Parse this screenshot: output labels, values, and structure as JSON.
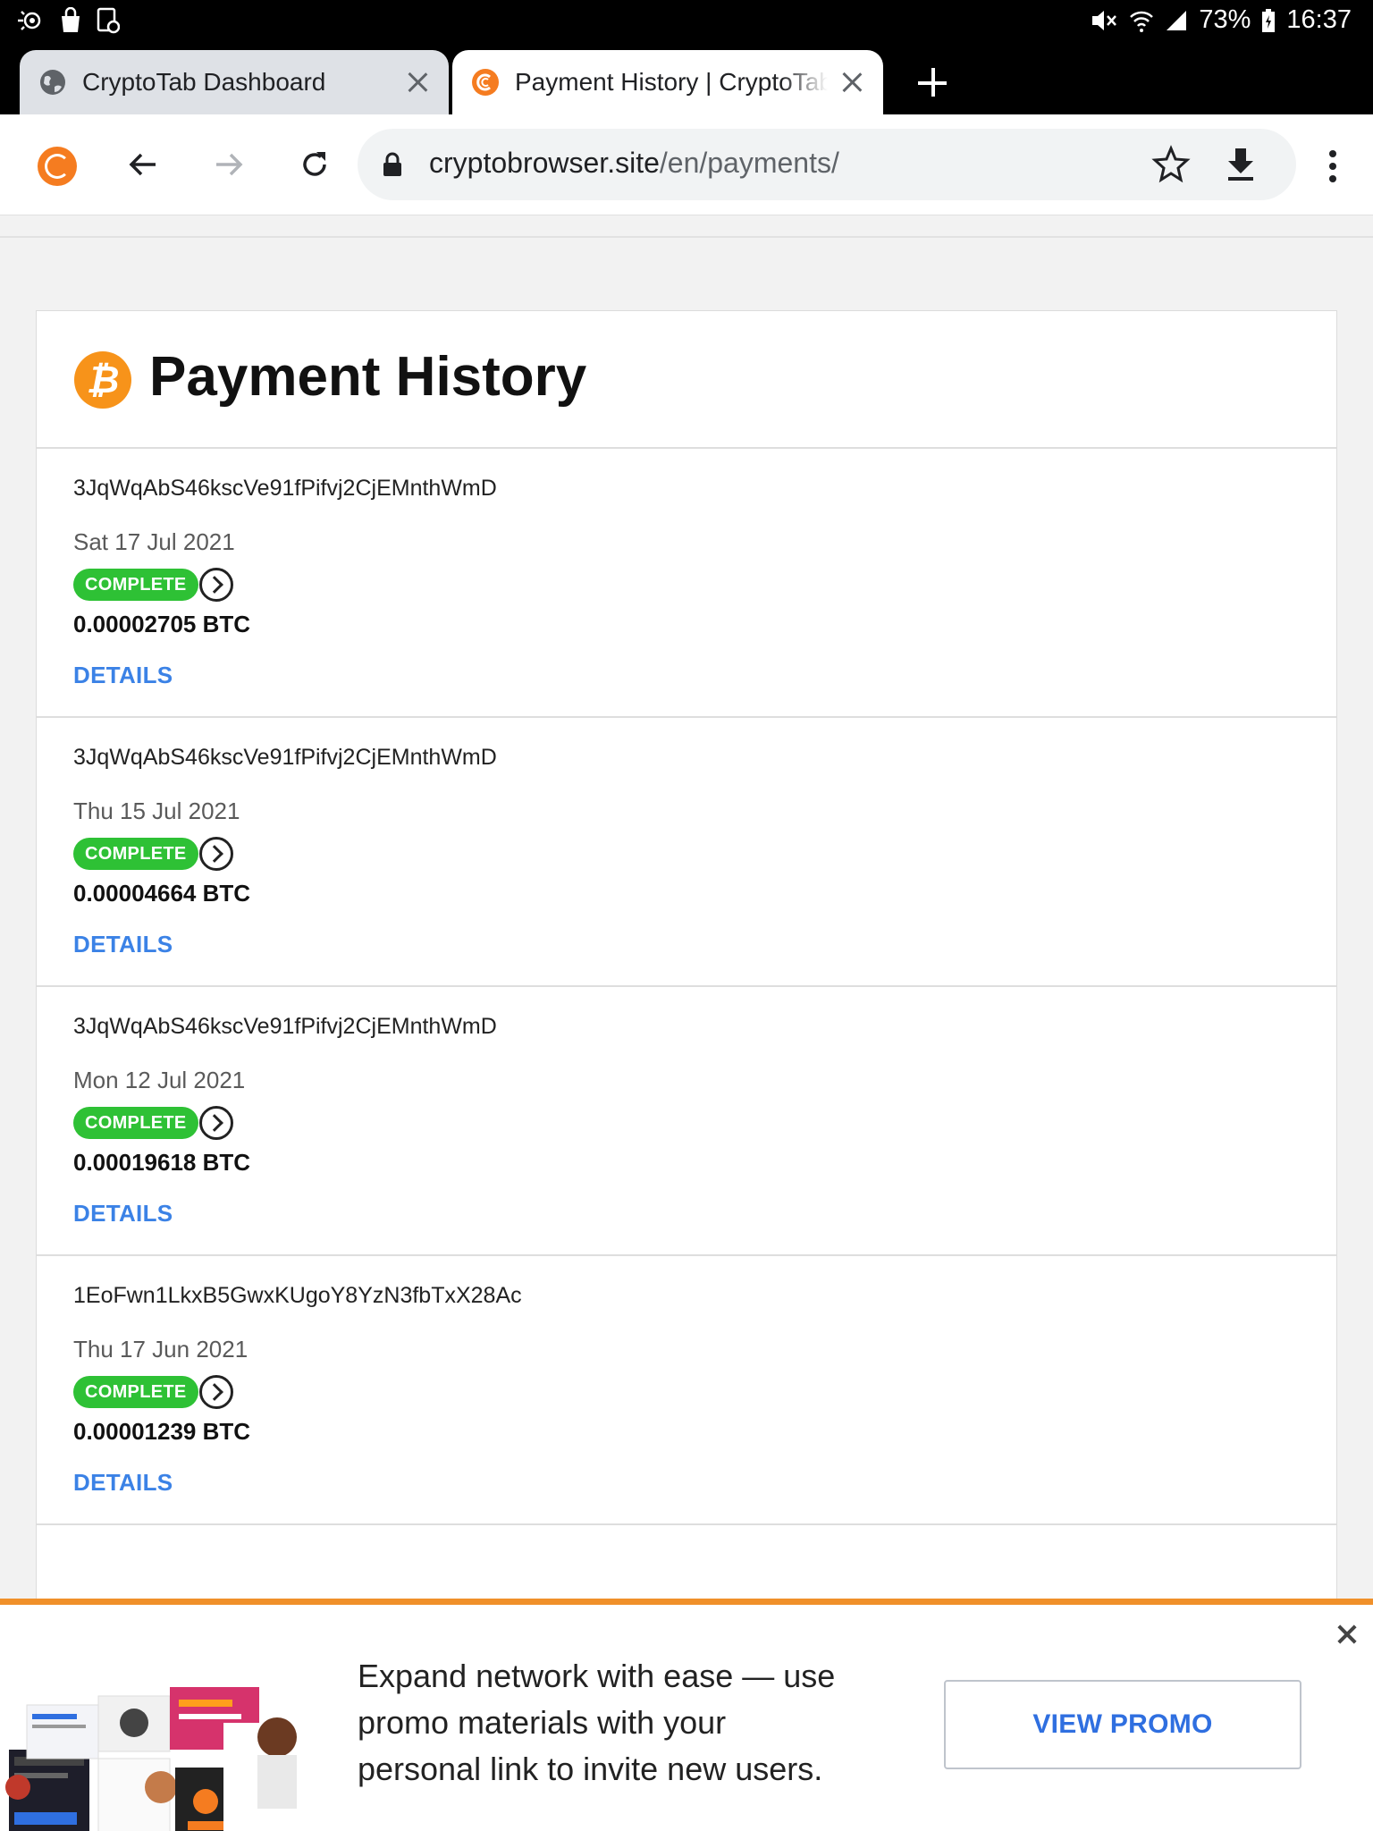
{
  "status_bar": {
    "battery": "73%",
    "time": "16:37"
  },
  "tabs": [
    {
      "title": "CryptoTab Dashboard",
      "active": false,
      "favicon": "globe-icon"
    },
    {
      "title": "Payment History | CryptoTab",
      "active": true,
      "favicon": "cryptotab-icon"
    }
  ],
  "toolbar": {
    "url_domain": "cryptobrowser.site",
    "url_path": "/en/payments/"
  },
  "page": {
    "title": "Payment History"
  },
  "payments": [
    {
      "address": "3JqWqAbS46kscVe91fPifvj2CjEMnthWmD",
      "date": "Sat 17 Jul 2021",
      "status": "COMPLETE",
      "amount": "0.00002705 BTC",
      "details": "DETAILS"
    },
    {
      "address": "3JqWqAbS46kscVe91fPifvj2CjEMnthWmD",
      "date": "Thu 15 Jul 2021",
      "status": "COMPLETE",
      "amount": "0.00004664 BTC",
      "details": "DETAILS"
    },
    {
      "address": "3JqWqAbS46kscVe91fPifvj2CjEMnthWmD",
      "date": "Mon 12 Jul 2021",
      "status": "COMPLETE",
      "amount": "0.00019618 BTC",
      "details": "DETAILS"
    },
    {
      "address": "1EoFwn1LkxB5GwxKUgoY8YzN3fbTxX28Ac",
      "date": "Thu 17 Jun 2021",
      "status": "COMPLETE",
      "amount": "0.00001239 BTC",
      "details": "DETAILS"
    }
  ],
  "promo": {
    "text": "Expand network with ease — use promo materials with your personal link to invite new users.",
    "button": "VIEW PROMO"
  },
  "colors": {
    "accent_orange": "#f57c20",
    "bitcoin": "#f7931a",
    "status_green": "#2ec135",
    "link_blue": "#3b82e6"
  }
}
